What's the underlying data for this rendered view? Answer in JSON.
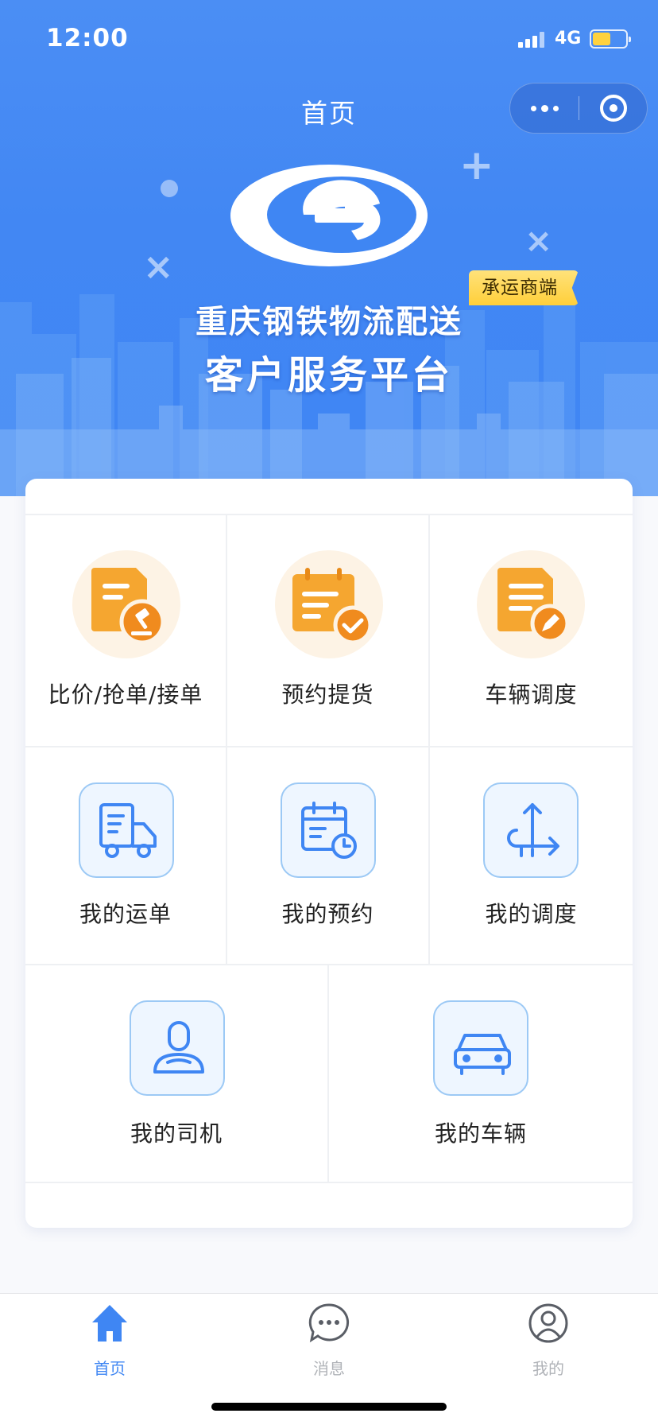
{
  "status_bar": {
    "time": "12:00",
    "network": "4G"
  },
  "nav": {
    "title": "首页"
  },
  "banner": {
    "badge": "承运商端",
    "title_line1": "重庆钢铁物流配送",
    "title_line2": "客户服务平台"
  },
  "colors": {
    "primary": "#3f86f3",
    "orange_icon": "#f5a630",
    "blue_icon": "#3f86f3",
    "badge_yellow": "#ffd23f"
  },
  "services": [
    {
      "label": "比价/抢单/接单",
      "icon": "document-gavel-icon"
    },
    {
      "label": "预约提货",
      "icon": "calendar-check-icon"
    },
    {
      "label": "车辆调度",
      "icon": "document-edit-icon"
    },
    {
      "label": "我的运单",
      "icon": "truck-waybill-icon"
    },
    {
      "label": "我的预约",
      "icon": "calendar-clock-icon"
    },
    {
      "label": "我的调度",
      "icon": "route-dispatch-icon"
    },
    {
      "label": "我的司机",
      "icon": "driver-icon"
    },
    {
      "label": "我的车辆",
      "icon": "car-icon"
    }
  ],
  "tabbar": [
    {
      "label": "首页",
      "icon": "home-icon",
      "active": true
    },
    {
      "label": "消息",
      "icon": "chat-bubble-icon",
      "active": false
    },
    {
      "label": "我的",
      "icon": "user-circle-icon",
      "active": false
    }
  ]
}
